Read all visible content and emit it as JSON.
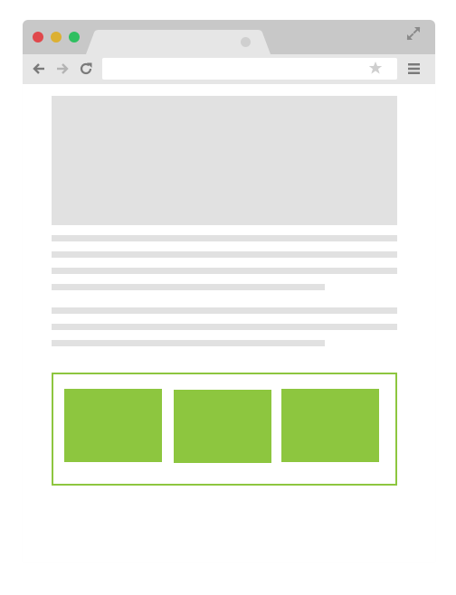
{
  "browser": {
    "traffic_lights": {
      "close_color": "#e0484c",
      "minimize_color": "#dcb032",
      "zoom_color": "#2fbf60"
    },
    "tab": {
      "title": "",
      "close_icon": "close-dot-icon"
    },
    "toolbar": {
      "back_icon": "arrow-left-icon",
      "forward_icon": "arrow-right-icon",
      "reload_icon": "reload-icon",
      "address_value": "",
      "address_placeholder": "",
      "bookmark_icon": "star-icon",
      "menu_icon": "hamburger-menu-icon",
      "expand_icon": "expand-arrows-icon"
    }
  },
  "page": {
    "image_placeholder_color": "#e1e1e1",
    "text_placeholder_color": "#e1e1e1",
    "paragraphs": [
      {
        "lines": 4
      },
      {
        "lines": 3
      }
    ],
    "feature_group": {
      "accent_color": "#8dc63f",
      "cards": 3
    }
  }
}
